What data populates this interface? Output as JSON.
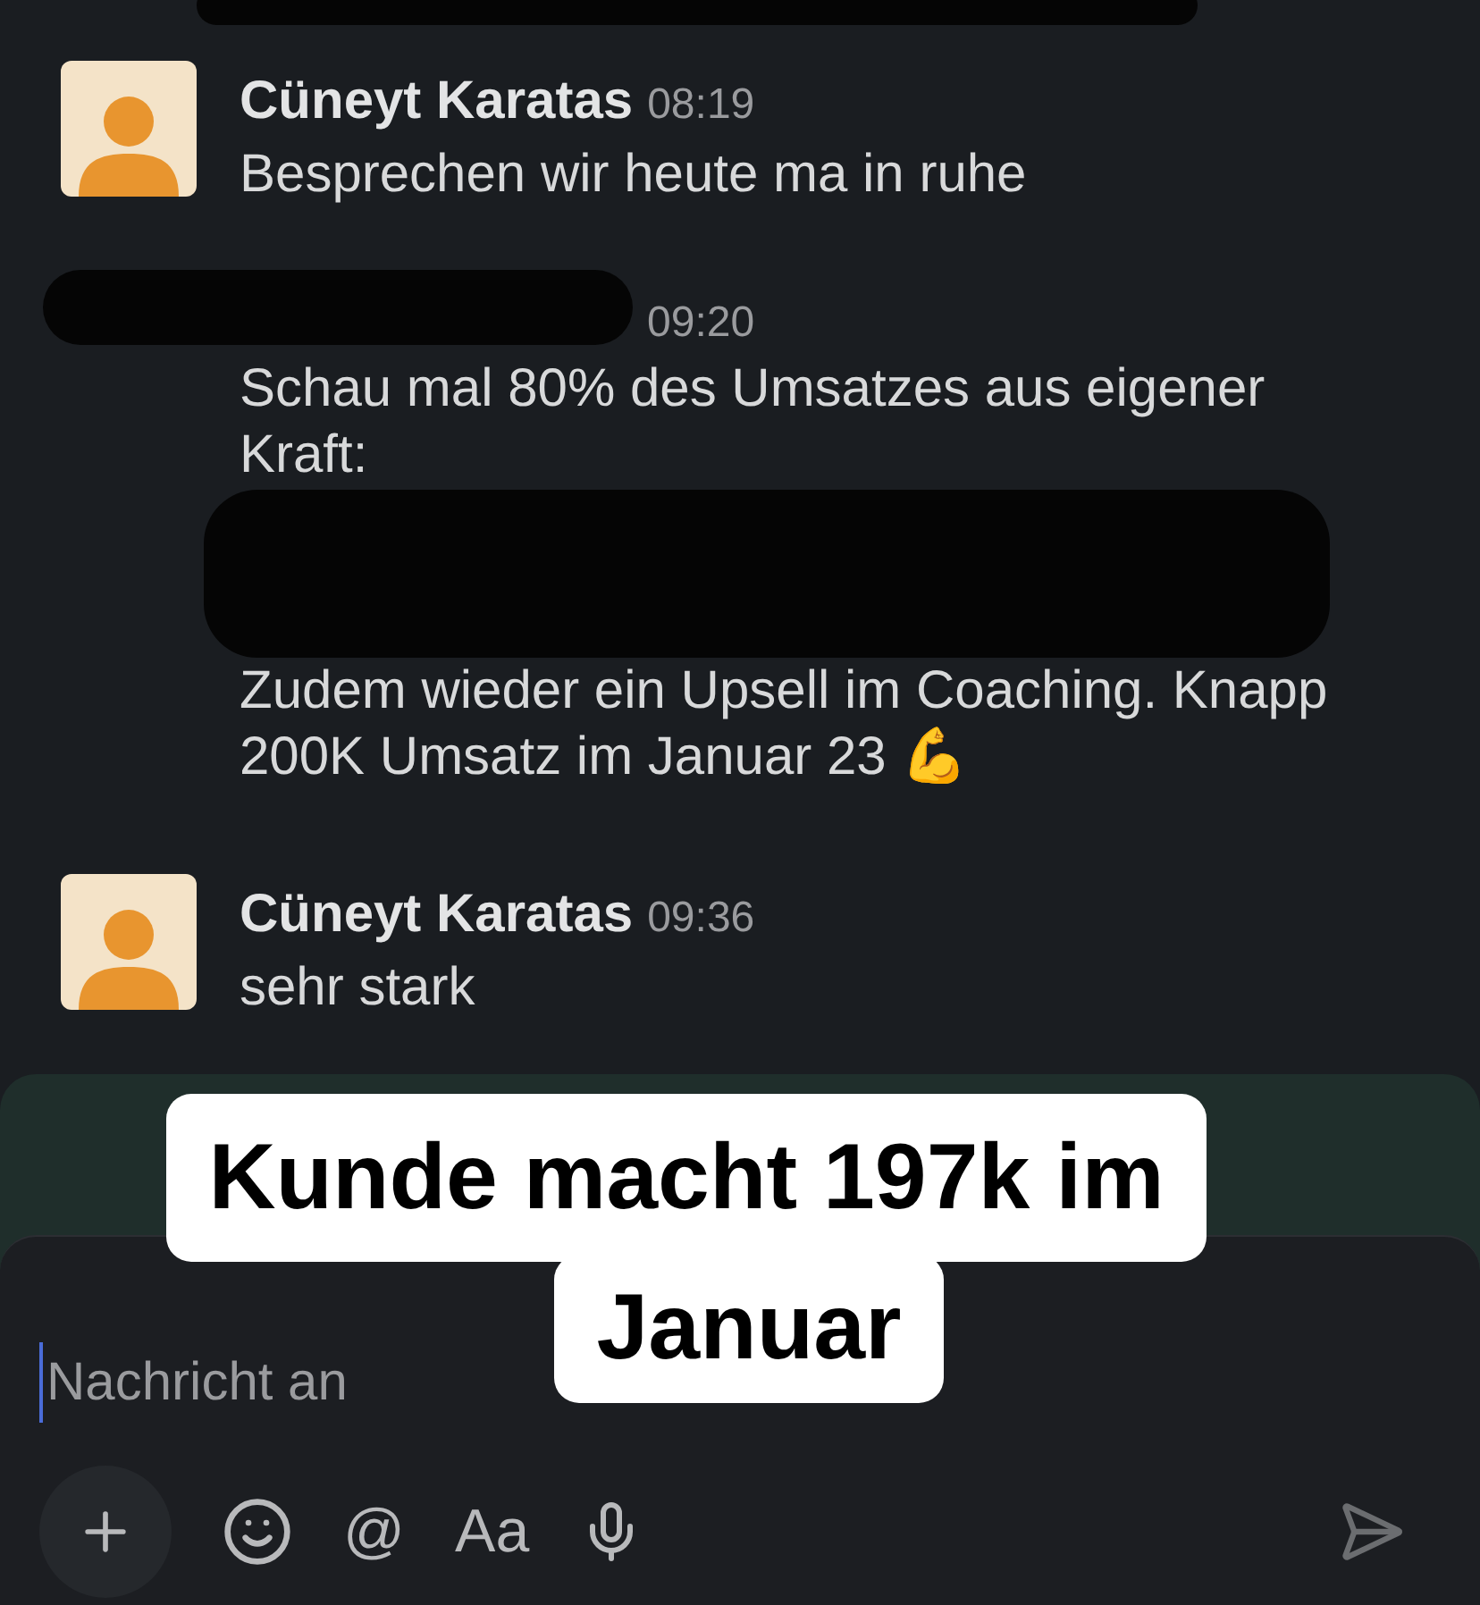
{
  "messages": [
    {
      "kind": "plain",
      "author": "Cüneyt Karatas",
      "time": "08:19",
      "text": "Besprechen wir heute ma in ruhe"
    },
    {
      "kind": "redacted",
      "time": "09:20",
      "text": "Schau mal 80% des Umsatzes aus eigener Kraft:",
      "text_after": "Zudem wieder ein Upsell im Coaching. Knapp 200K Umsatz im Januar 23",
      "emoji": "💪"
    },
    {
      "kind": "plain",
      "author": "Cüneyt Karatas",
      "time": "09:36",
      "text": "sehr stark"
    }
  ],
  "composer": {
    "placeholder": "Nachricht an",
    "toolbar": [
      "@",
      "Aa"
    ]
  },
  "caption": [
    "Kunde macht 197k im",
    "Januar"
  ]
}
